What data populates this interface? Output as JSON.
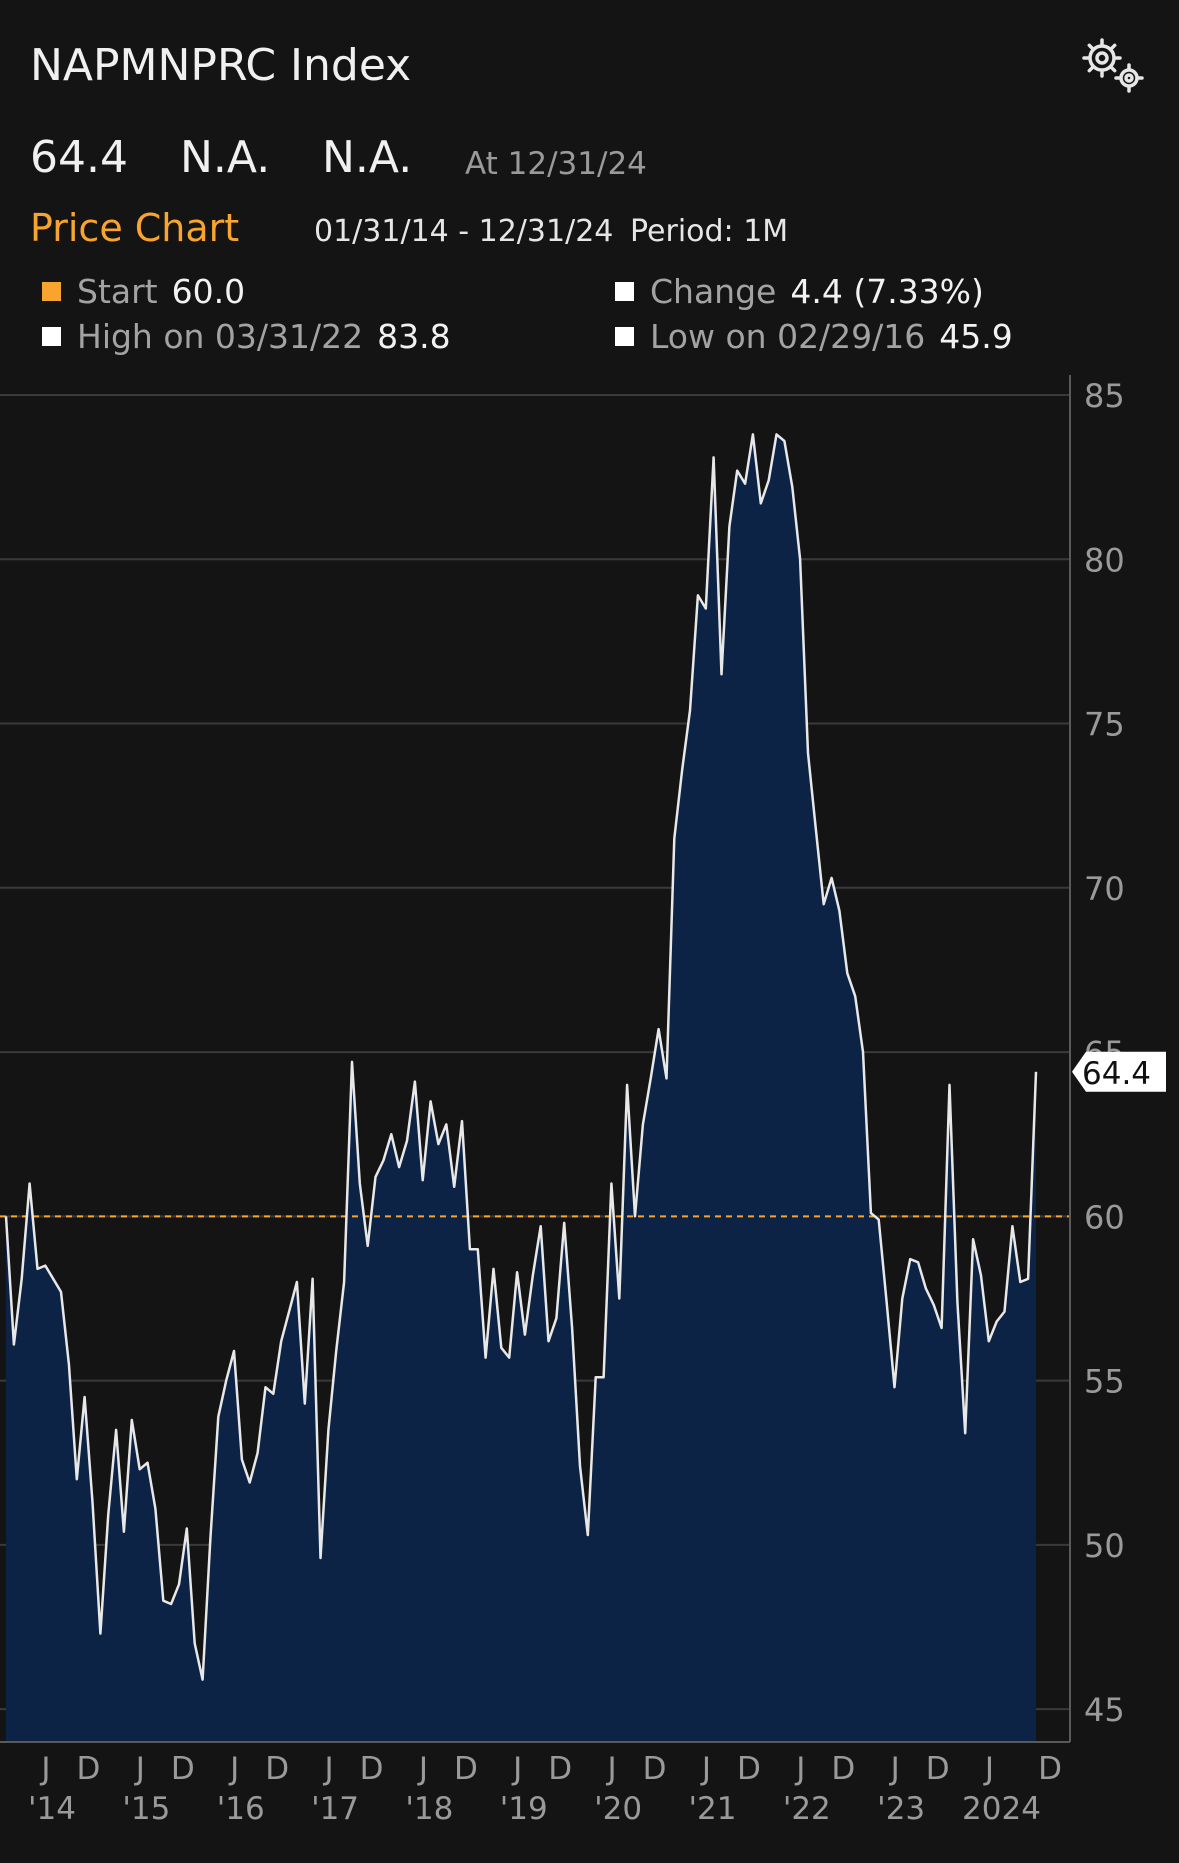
{
  "header": {
    "title": "NAPMNPRC Index",
    "settings_icon": "gears-icon"
  },
  "quote": {
    "last": "64.4",
    "change": "N.A.",
    "pct_change": "N.A.",
    "as_of": "At 12/31/24"
  },
  "price_chart": {
    "label": "Price Chart",
    "range": "01/31/14 - 12/31/24",
    "period": "Period: 1M"
  },
  "stats": {
    "start_label": "Start",
    "start_value": "60.0",
    "change_label": "Change",
    "change_value": "4.4 (7.33%)",
    "high_label": "High on 03/31/22",
    "high_value": "83.8",
    "low_label": "Low on 02/29/16",
    "low_value": "45.9"
  },
  "colors": {
    "background": "#141414",
    "accent": "#f7a52e",
    "area_fill": "#0c2346",
    "line": "#e8e8e8",
    "grid": "#3a3a3a",
    "axis_text": "#9a9a9a"
  },
  "chart_data": {
    "type": "area",
    "series": [
      {
        "values": [
          60.0,
          56.1,
          58.1,
          61.0,
          58.4,
          58.5,
          58.1,
          57.7,
          55.5,
          52.0,
          54.5,
          51.3,
          47.3,
          50.9,
          53.5,
          50.4,
          53.8,
          52.3,
          52.5,
          51.1,
          48.3,
          48.2,
          48.8,
          50.5,
          47.0,
          45.9,
          50.2,
          53.9,
          55.0,
          55.9,
          52.6,
          51.9,
          52.8,
          54.8,
          54.6,
          56.2,
          57.1,
          58.0,
          54.3,
          58.1,
          49.6,
          53.5,
          55.9,
          58.0,
          64.7,
          61.0,
          59.1,
          61.2,
          61.7,
          62.5,
          61.5,
          62.3,
          64.1,
          61.1,
          63.5,
          62.2,
          62.8,
          60.9,
          62.9,
          59.0,
          59.0,
          55.7,
          58.4,
          56.0,
          55.7,
          58.3,
          56.4,
          58.2,
          59.7,
          56.2,
          56.9,
          59.8,
          56.6,
          52.4,
          50.3,
          55.1,
          55.1,
          61.0,
          57.5,
          64.0,
          60.0,
          62.8,
          64.2,
          65.7,
          64.2,
          71.5,
          73.6,
          75.4,
          78.9,
          78.5,
          83.1,
          76.5,
          81.0,
          82.7,
          82.3,
          83.8,
          81.7,
          82.4,
          83.8,
          83.6,
          82.2,
          80.0,
          74.1,
          71.8,
          69.5,
          70.3,
          69.3,
          67.4,
          66.7,
          65.0,
          60.1,
          59.9,
          57.4,
          54.8,
          57.5,
          58.7,
          58.6,
          57.8,
          57.3,
          56.6,
          64.0,
          57.4,
          53.4,
          59.3,
          58.2,
          56.2,
          56.8,
          57.1,
          59.7,
          58.0,
          58.1,
          64.4
        ]
      }
    ],
    "x_start": "01/31/14",
    "x_end": "12/31/24",
    "start_value": 60.0,
    "last_value": 64.4,
    "last_value_label": "64.4",
    "ylim": [
      44,
      85
    ],
    "yticks": [
      45,
      50,
      55,
      60,
      65,
      70,
      75,
      80,
      85
    ],
    "ytick_labels": [
      "45",
      "50",
      "55",
      "60",
      "65",
      "70",
      "75",
      "80",
      "85"
    ],
    "xticks": [
      {
        "label": "J",
        "year": "'14"
      },
      {
        "label": "D",
        "year": ""
      },
      {
        "label": "J",
        "year": "'15"
      },
      {
        "label": "D",
        "year": ""
      },
      {
        "label": "J",
        "year": "'16"
      },
      {
        "label": "D",
        "year": ""
      },
      {
        "label": "J",
        "year": "'17"
      },
      {
        "label": "D",
        "year": ""
      },
      {
        "label": "J",
        "year": "'18"
      },
      {
        "label": "D",
        "year": ""
      },
      {
        "label": "J",
        "year": "'19"
      },
      {
        "label": "D",
        "year": ""
      },
      {
        "label": "J",
        "year": "'20"
      },
      {
        "label": "D",
        "year": ""
      },
      {
        "label": "J",
        "year": "'21"
      },
      {
        "label": "D",
        "year": ""
      },
      {
        "label": "J",
        "year": "'22"
      },
      {
        "label": "D",
        "year": ""
      },
      {
        "label": "J",
        "year": "'23"
      },
      {
        "label": "D",
        "year": ""
      },
      {
        "label": "J",
        "year": "2024"
      },
      {
        "label": "D",
        "year": ""
      }
    ],
    "grid": true,
    "axis_side": "right"
  }
}
